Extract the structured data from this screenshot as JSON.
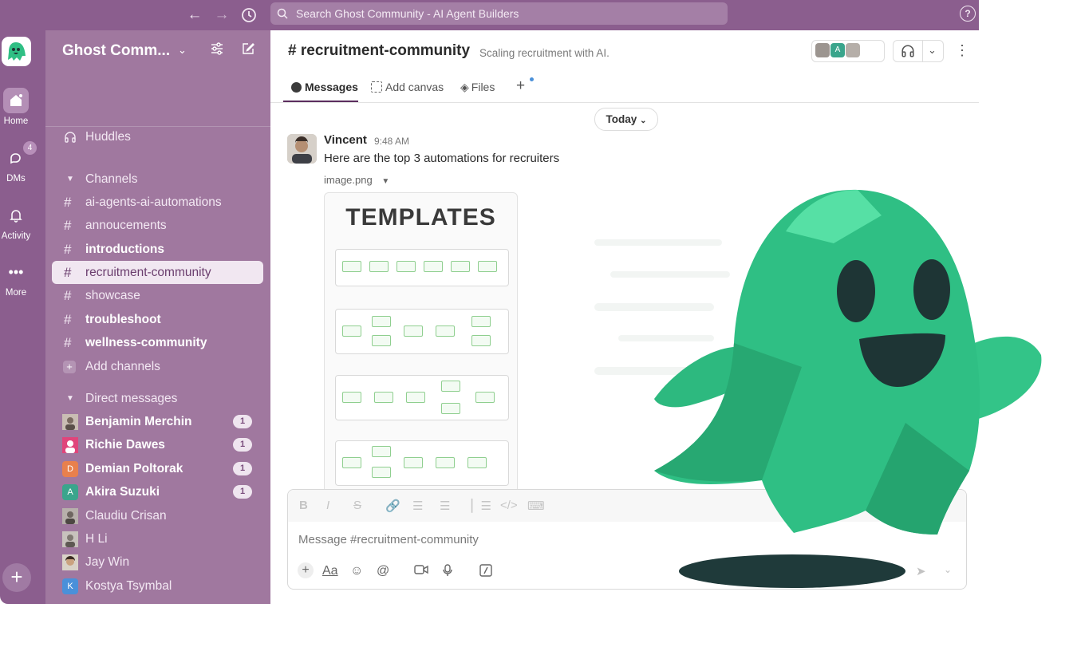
{
  "topbar": {
    "search_placeholder": "Search Ghost Community - AI Agent Builders",
    "help": "?"
  },
  "rail": {
    "items": [
      {
        "label": "Home",
        "icon": "home-icon"
      },
      {
        "label": "DMs",
        "icon": "dms-icon",
        "badge": "4"
      },
      {
        "label": "Activity",
        "icon": "bell-icon"
      },
      {
        "label": "More",
        "icon": "more-icon"
      }
    ],
    "add": "+"
  },
  "sidebar": {
    "workspace_name": "Ghost Comm...",
    "huddles": "Huddles",
    "channels_header": "Channels",
    "channels": [
      {
        "name": "ai-agents-ai-automations",
        "bold": false,
        "selected": false
      },
      {
        "name": "annoucements",
        "bold": false,
        "selected": false
      },
      {
        "name": "introductions",
        "bold": true,
        "selected": false
      },
      {
        "name": "recruitment-community",
        "bold": false,
        "selected": true
      },
      {
        "name": "showcase",
        "bold": false,
        "selected": false
      },
      {
        "name": "troubleshoot",
        "bold": true,
        "selected": false
      },
      {
        "name": "wellness-community",
        "bold": true,
        "selected": false
      }
    ],
    "add_channels": "Add channels",
    "dm_header": "Direct messages",
    "dms": [
      {
        "name": "Benjamin Merchin",
        "bold": true,
        "count": "1",
        "initial": "",
        "color": "#8a7f7a"
      },
      {
        "name": "Richie Dawes",
        "bold": true,
        "count": "1",
        "initial": "",
        "color": "#e0457b"
      },
      {
        "name": "Demian Poltorak",
        "bold": true,
        "count": "1",
        "initial": "D",
        "color": "#e8804d"
      },
      {
        "name": "Akira Suzuki",
        "bold": true,
        "count": "1",
        "initial": "A",
        "color": "#3aa58c"
      },
      {
        "name": "Claudiu Crisan",
        "bold": false,
        "count": "",
        "initial": "",
        "color": "#8a8a8a"
      },
      {
        "name": "H Li",
        "bold": false,
        "count": "",
        "initial": "",
        "color": "#8a8a8a"
      },
      {
        "name": "Jay Win",
        "bold": false,
        "count": "",
        "initial": "",
        "color": "#7a8f6f"
      },
      {
        "name": "Kostya Tsymbal",
        "bold": false,
        "count": "",
        "initial": "K",
        "color": "#4a90d9"
      }
    ]
  },
  "channel": {
    "title": "recruitment-community",
    "hash": "#",
    "description": "Scaling recruitment with AI.",
    "tabs": [
      {
        "label": "Messages",
        "icon": "message-icon"
      },
      {
        "label": "Add canvas",
        "icon": "canvas-icon"
      },
      {
        "label": "Files",
        "icon": "files-icon"
      }
    ],
    "add_tab": "+"
  },
  "feed": {
    "date_divider": "Today",
    "message": {
      "author": "Vincent",
      "time": "9:48 AM",
      "text": "Here are the top 3 automations for recruiters",
      "attachment_name": "image.png",
      "attachment_title": "TEMPLATES"
    }
  },
  "composer": {
    "placeholder": "Message #recruitment-community",
    "format_icons": [
      "B",
      "I",
      "S"
    ]
  },
  "colors": {
    "aubergine": "#8b5e8e",
    "sidebar": "#a0789f",
    "ghost_green": "#2fbf84",
    "shadow": "#1f3a3a"
  }
}
